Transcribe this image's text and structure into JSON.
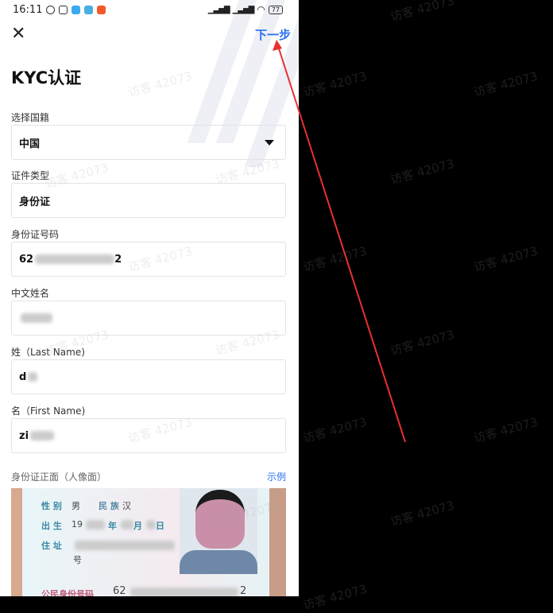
{
  "status": {
    "time": "16:11",
    "battery": "77"
  },
  "header": {
    "next_label": "下一步",
    "title": "KYC认证"
  },
  "form": {
    "nationality": {
      "label": "选择国籍",
      "value": "中国"
    },
    "id_type": {
      "label": "证件类型",
      "value": "身份证"
    },
    "id_number": {
      "label": "身份证号码",
      "prefix": "62",
      "suffix": "2"
    },
    "chinese_name": {
      "label": "中文姓名"
    },
    "last_name": {
      "label": "姓（Last Name)",
      "prefix": "d"
    },
    "first_name": {
      "label": "名（First Name)",
      "prefix": "zi"
    }
  },
  "id_front": {
    "label": "身份证正面（人像面）",
    "example_label": "示例",
    "card": {
      "sex_label": "性 别",
      "sex": "男",
      "ethnic_label": "民 族",
      "ethnic": "汉",
      "birth_label": "出 生",
      "birth_year": "19",
      "year": "年",
      "month": "月",
      "day": "日",
      "address_label": "住 址",
      "address_end": "号",
      "id_label": "公民身份号码",
      "id_prefix": "62",
      "id_suffix": "2"
    }
  },
  "watermark": "访客 42073",
  "colors": {
    "accent": "#2b6ff0",
    "arrow": "#e8312f"
  }
}
